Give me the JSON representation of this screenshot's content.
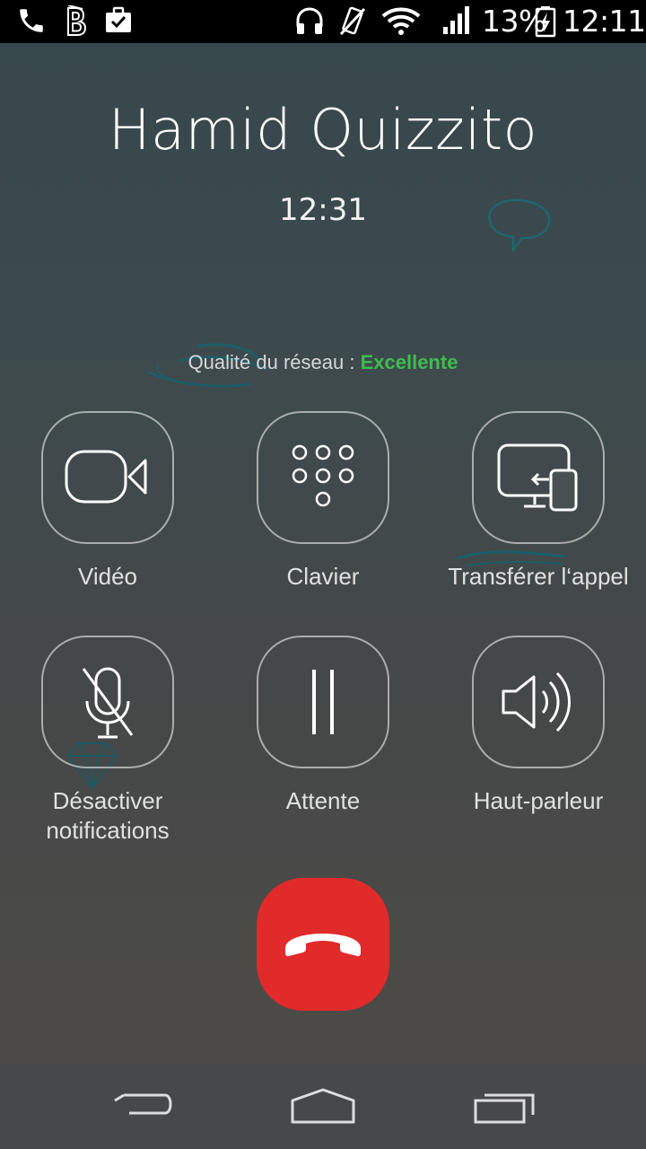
{
  "status_bar": {
    "battery": "13%",
    "time": "12:11",
    "icons": [
      "phone-icon",
      "b-app-icon",
      "briefcase-check-icon",
      "headphones-icon",
      "vibrate-off-icon",
      "wifi-icon",
      "signal-icon",
      "battery-charging-icon"
    ]
  },
  "call": {
    "caller_name": "Hamid Quizzito",
    "duration": "12:31",
    "network_label": "Qualité du réseau :",
    "network_quality": "Excellente",
    "quality_color": "#3dbd4c"
  },
  "actions": [
    {
      "id": "video",
      "label": "Vidéo",
      "icon": "video-camera-icon"
    },
    {
      "id": "keypad",
      "label": "Clavier",
      "icon": "dialpad-icon"
    },
    {
      "id": "transfer",
      "label": "Transférer l‘appel",
      "icon": "transfer-device-icon"
    },
    {
      "id": "mute",
      "label_line1": "Désactiver",
      "label_line2": "notifications",
      "icon": "mic-off-icon"
    },
    {
      "id": "hold",
      "label": "Attente",
      "icon": "pause-icon"
    },
    {
      "id": "speaker",
      "label": "Haut-parleur",
      "icon": "speaker-icon"
    }
  ],
  "end_call": {
    "icon": "end-call-icon",
    "color": "#e12a2a"
  },
  "nav": {
    "icons": [
      "back-icon",
      "home-icon",
      "recents-icon"
    ]
  }
}
